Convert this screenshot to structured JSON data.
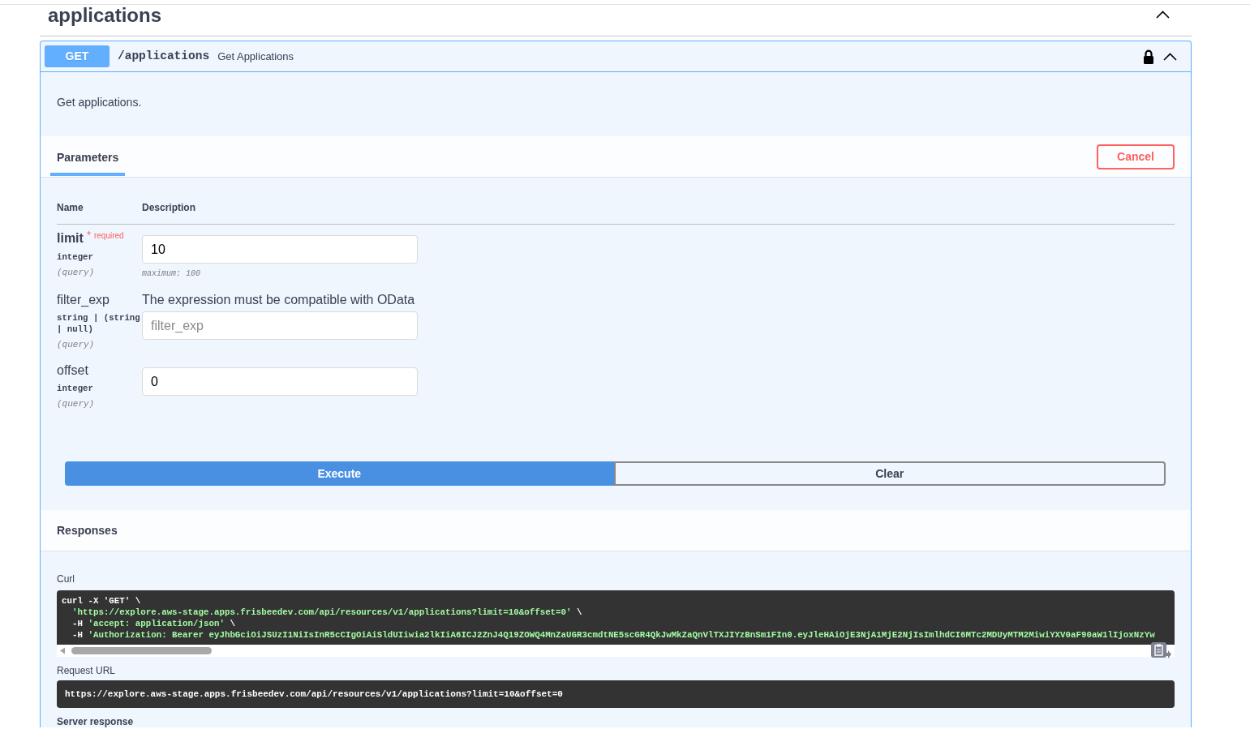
{
  "section": {
    "title": "applications",
    "expanded": true
  },
  "operation": {
    "method": "GET",
    "path": "/applications",
    "summary": "Get Applications",
    "locked": true,
    "expanded": true,
    "description": "Get applications."
  },
  "parameters": {
    "tabs": [
      {
        "label": "Parameters",
        "selected": true
      }
    ],
    "cancel_button": "Cancel",
    "columns": [
      "Name",
      "Description"
    ],
    "rows": [
      {
        "name": "limit",
        "required": true,
        "required_mark": "*",
        "required_text": "required",
        "type": "integer",
        "location": "(query)",
        "input": {
          "value": "10"
        },
        "constraint": "maximum: 100"
      },
      {
        "name": "filter_exp",
        "required": false,
        "type": "string | (string | null)",
        "location": "(query)",
        "description": "The expression must be compatible with OData",
        "input": {
          "placeholder": "filter_exp"
        }
      },
      {
        "name": "offset",
        "required": false,
        "type": "integer",
        "location": "(query)",
        "input": {
          "value": "0"
        }
      }
    ]
  },
  "actions": [
    {
      "label": "Execute",
      "kind": "primary"
    },
    {
      "label": "Clear",
      "kind": "secondary"
    }
  ],
  "responses": {
    "title": "Responses",
    "curl": {
      "label": "Curl",
      "lines": [
        {
          "parts": [
            {
              "text": "curl -X ",
              "kind": "plain"
            },
            {
              "text": "'GET'",
              "kind": "plain"
            },
            {
              "text": " \\",
              "kind": "plain"
            }
          ]
        },
        {
          "parts": [
            {
              "text": "'https://explore.aws-stage.apps.frisbeedev.com/api/resources/v1/applications?limit=10&offset=0'",
              "kind": "string"
            },
            {
              "text": " \\",
              "kind": "plain"
            }
          ]
        },
        {
          "parts": [
            {
              "text": "-H ",
              "kind": "plain"
            },
            {
              "text": "'accept: application/json'",
              "kind": "string"
            },
            {
              "text": " \\",
              "kind": "plain"
            }
          ]
        },
        {
          "parts": [
            {
              "text": "-H ",
              "kind": "plain"
            },
            {
              "text": "'Authorization: Bearer eyJhbGciOiJSUzI1NiIsInR5cCIgOiAiSldUIiwia2lkIiA6ICJ2ZnJ4Q19ZOWQ4MnZaUGR3cmdtNE5scGR4QkJwMkZaQnVlTXJIYzBnSm1FIn0.eyJleHAiOjE3NjA1MjE2NjIsImlhdCI6MTc2MDUyMTM2MiwiYXV0aF90aW1lIjoxNzYw",
              "kind": "string"
            }
          ]
        }
      ]
    },
    "request_url": {
      "label": "Request URL",
      "value": "https://explore.aws-stage.apps.frisbeedev.com/api/resources/v1/applications?limit=10&offset=0"
    },
    "server_response": {
      "label": "Server response"
    }
  }
}
